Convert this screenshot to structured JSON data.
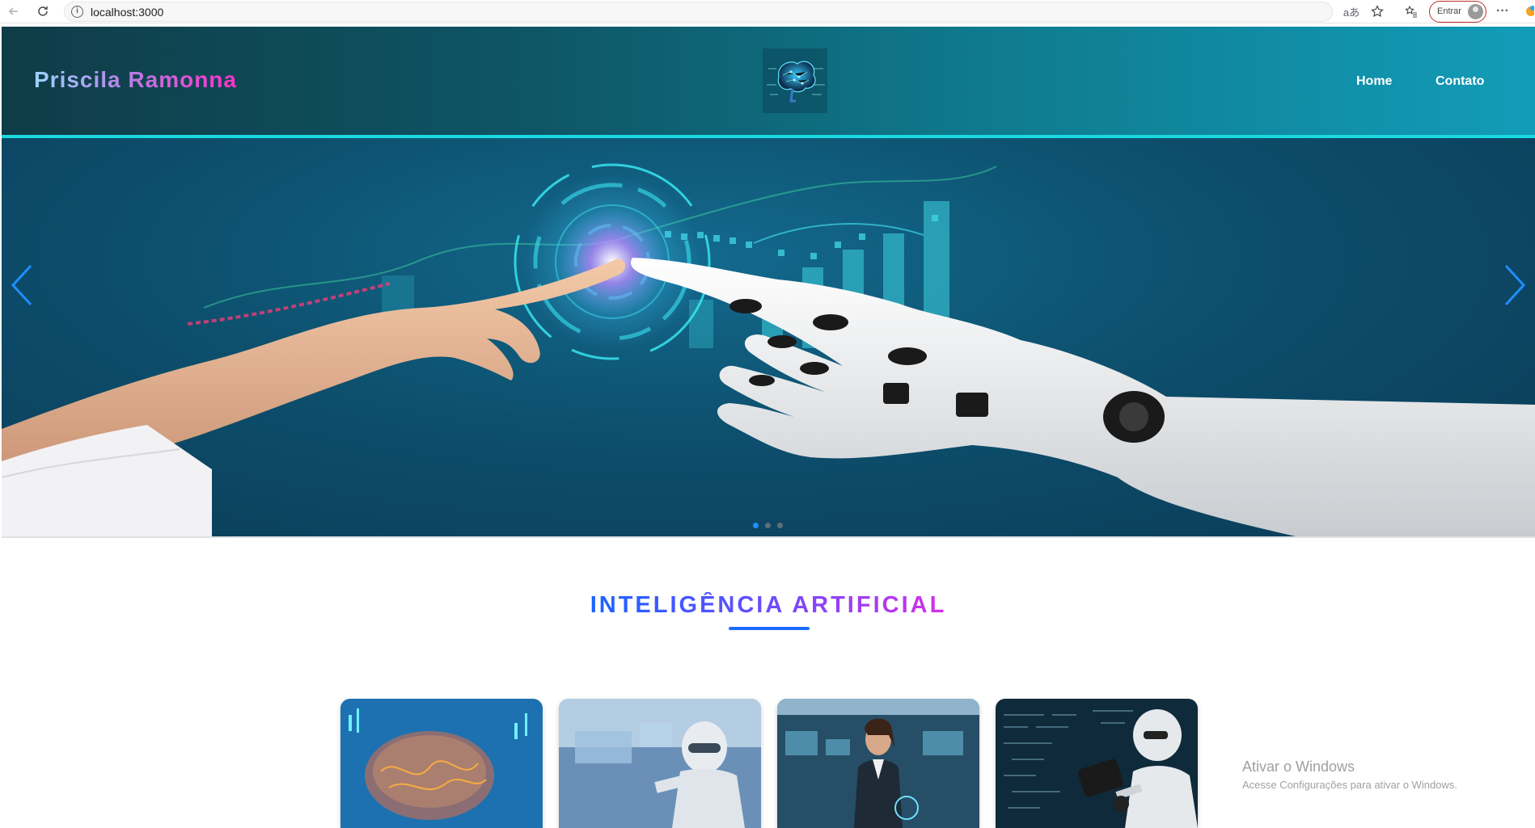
{
  "browser": {
    "url": "localhost:3000",
    "signin_label": "Entrar"
  },
  "header": {
    "title": "Priscila Ramonna",
    "nav": [
      {
        "label": "Home"
      },
      {
        "label": "Contato"
      }
    ]
  },
  "carousel": {
    "slide_count": 3,
    "active_index": 0
  },
  "section": {
    "title": "INTELIGÊNCIA ARTIFICIAL"
  },
  "cards": [
    {
      "image": "brain-circuit"
    },
    {
      "image": "robot-dashboard"
    },
    {
      "image": "businesswoman-office"
    },
    {
      "image": "robot-math"
    }
  ],
  "watermark": {
    "title": "Ativar o Windows",
    "subtitle": "Acesse Configurações para ativar o Windows."
  },
  "colors": {
    "header_start": "#0f3c47",
    "header_end": "#129cb8",
    "accent_line": "#1ad9e0",
    "title_blue": "#1a63ff",
    "title_pink": "#d52fe8",
    "underline": "#1e6cff",
    "signin_border": "#c42b2b"
  }
}
